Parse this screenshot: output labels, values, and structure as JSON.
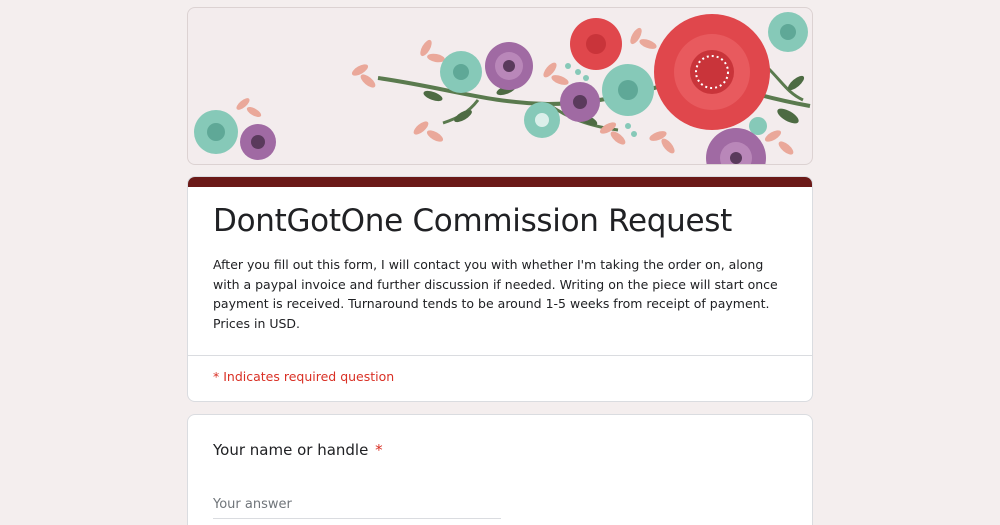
{
  "form": {
    "title": "DontGotOne Commission Request",
    "description": "After you fill out this form, I will contact you with whether I'm taking the order on, along with a paypal invoice and further discussion if needed. Writing on the piece will start once payment is received. Turnaround tends to be around 1-5 weeks from receipt of payment. Prices in USD.",
    "required_note": "* Indicates required question",
    "theme": {
      "accent": "#6b1a18",
      "background": "#f4eeee",
      "required": "#d93025"
    }
  },
  "banner": {
    "icon": "floral-header-image",
    "colors": {
      "red_flower": "#e0474c",
      "purple_flower": "#a06aa3",
      "teal_flower": "#86c9b8",
      "pink_leaf": "#eaa89a",
      "stem": "#5a7a4e"
    }
  },
  "questions": [
    {
      "label": "Your name or handle",
      "required_marker": "*",
      "placeholder": "Your answer",
      "value": ""
    }
  ]
}
